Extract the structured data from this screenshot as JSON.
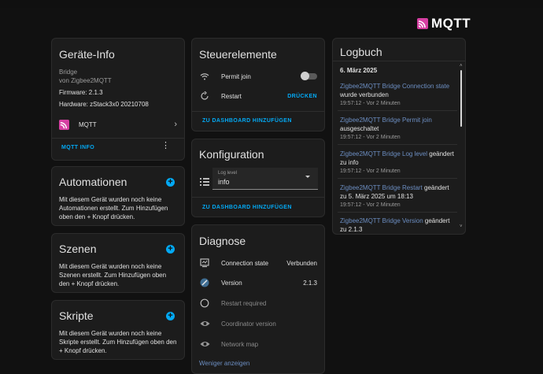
{
  "brand": {
    "name": "MQTT",
    "icon": "mqtt-logo-icon",
    "accent": "#d63fa2"
  },
  "colors": {
    "link": "#03a9f4",
    "log_link": "#6c8ec2",
    "card_bg": "#1c1c1c",
    "page_bg": "#111111"
  },
  "device_info": {
    "title": "Geräte-Info",
    "model": "Bridge",
    "manufacturer": "von Zigbee2MQTT",
    "firmware": "Firmware: 2.1.3",
    "hardware": "Hardware: zStack3x0 20210708",
    "integration": "MQTT",
    "action": "MQTT INFO"
  },
  "automations": {
    "title": "Automationen",
    "text": "Mit diesem Gerät wurden noch keine Automationen erstellt. Zum Hinzufügen oben den + Knopf drücken."
  },
  "scenes": {
    "title": "Szenen",
    "text": "Mit diesem Gerät wurden noch keine Szenen erstellt. Zum Hinzufügen oben den + Knopf drücken."
  },
  "scripts": {
    "title": "Skripte",
    "text": "Mit diesem Gerät wurden noch keine Skripte erstellt. Zum Hinzufügen oben den + Knopf drücken."
  },
  "controls": {
    "title": "Steuerelemente",
    "permit_join": "Permit join",
    "permit_join_state": "off",
    "restart": "Restart",
    "restart_action": "DRÜCKEN",
    "add_to_dashboard": "ZU DASHBOARD HINZUFÜGEN"
  },
  "configuration": {
    "title": "Konfiguration",
    "log_level_label": "Log level",
    "log_level_value": "info",
    "add_to_dashboard": "ZU DASHBOARD HINZUFÜGEN"
  },
  "diagnostics": {
    "title": "Diagnose",
    "items": [
      {
        "label": "Connection state",
        "value": "Verbunden",
        "icon": "connection-icon"
      },
      {
        "label": "Version",
        "value": "2.1.3",
        "icon": "version-icon"
      },
      {
        "label": "Restart required",
        "value": "",
        "icon": "circle-icon"
      },
      {
        "label": "Coordinator version",
        "value": "",
        "icon": "eye-icon"
      },
      {
        "label": "Network map",
        "value": "",
        "icon": "eye-icon"
      }
    ],
    "more": "Weniger anzeigen"
  },
  "logbook": {
    "title": "Logbuch",
    "date": "6. März 2025",
    "entries": [
      {
        "link": "Zigbee2MQTT Bridge Connection state",
        "text": " wurde verbunden",
        "time": "19:57:12 - Vor 2 Minuten"
      },
      {
        "link": "Zigbee2MQTT Bridge Permit join",
        "text": " ausgeschaltet",
        "time": "19:57:12 - Vor 2 Minuten"
      },
      {
        "link": "Zigbee2MQTT Bridge Log level",
        "text": " geändert zu info",
        "time": "19:57:12 - Vor 2 Minuten"
      },
      {
        "link": "Zigbee2MQTT Bridge Restart",
        "text": " geändert zu 5. März 2025 um 18:13",
        "time": "19:57:12 - Vor 2 Minuten"
      },
      {
        "link": "Zigbee2MQTT Bridge Version",
        "text": " geändert zu 2.1.3",
        "time": ""
      }
    ]
  }
}
